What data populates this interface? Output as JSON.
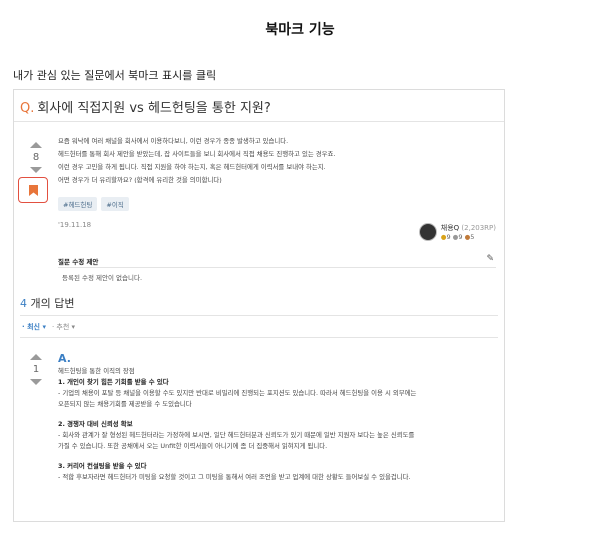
{
  "page_title": "북마크 기능",
  "intro": "내가 관심 있는 질문에서 북마크 표시를 클릭",
  "question": {
    "mark": "Q.",
    "title": "회사에 직접지원 vs 헤드헌팅을 통한 지원?",
    "votes": "8",
    "body": [
      "요즘 워낙에 여러 채널을 회사에서 이용하다보니, 이런 경우가 종종 발생하고 있습니다.",
      "헤드헌터를 통해 회사 제안을 받았는데, 잡 사이트들을 보니 회사에서 직접 채용도 진행하고 있는 경우죠.",
      "이런 경우 고민을 하게 됩니다. 직접 지원을 하야 하는지, 혹은 헤드헌터에게 이력서를 보내야 하는지.",
      "어떤 경우가 더 유리할까요? (합격에 유리한 것을 의미합니다)"
    ],
    "tags": [
      "#헤드헌팅",
      "#이직"
    ],
    "date": "'19.11.18",
    "author": {
      "name": "채용Q",
      "points": "(2,203RP)",
      "gold": "9",
      "silver": "9",
      "bronze": "5"
    },
    "edit_title": "질문 수정 제안",
    "edit_empty": "등록된 수정 제안이 없습니다."
  },
  "answers": {
    "count": "4",
    "label": "개의 답변",
    "sort_latest": "최신",
    "sort_recommend": "추천",
    "votes": "1",
    "mark": "A.",
    "body": [
      {
        "text": "헤드헌팅을 통한 이직의 장점",
        "bold": false
      },
      {
        "text": "1. 개인이 찾기 힘든 기회를 받을 수 있다",
        "bold": true
      },
      {
        "text": "- 기업의 채용이 포탈 등 채널을 이용할 수도 있지만 반대로 비밀리에 진행되는 포지션도 있습니다. 따라서 헤드헌팅을 이용 시 외부에는",
        "bold": false
      },
      {
        "text": "오픈되지 않는 채용기회를 제공받을 수 도있습니다",
        "bold": false
      },
      {
        "text": "",
        "bold": false
      },
      {
        "text": "2. 경쟁자 대비 신뢰성 확보",
        "bold": true
      },
      {
        "text": "- 회사와 관계가 잘 형성된 헤드헌터라는 가정하에 보시면, 일단 헤드헌터분과 신뢰도가 있기 때문에 일반 지원자 보다는 높은 신뢰도를",
        "bold": false
      },
      {
        "text": "가질 수 있습니다. 또한 공채에서 오는 Unfit한 이력서들이 아니기에 좀 더 집중해서 읽혀지게 됩니다.",
        "bold": false
      },
      {
        "text": "",
        "bold": false
      },
      {
        "text": "3. 커리어 컨설팅을 받을 수 있다",
        "bold": true
      },
      {
        "text": "- 적합 후보자라면 헤드헌터가 미팅을 요청할 것이고 그 미팅을 통해서 여러 조언을 받고 업계에 대한 상황도 들어보실 수 있을겁니다.",
        "bold": false
      }
    ]
  },
  "colors": {
    "question_mark": "#e8753a",
    "bookmark": "#e8753a",
    "bookmark_highlight": "#e25040",
    "accent": "#3b7fc4"
  },
  "icons": [
    "vote-up-icon",
    "vote-down-icon",
    "bookmark-icon",
    "pencil-icon",
    "caret-down-icon",
    "medal-icon"
  ]
}
